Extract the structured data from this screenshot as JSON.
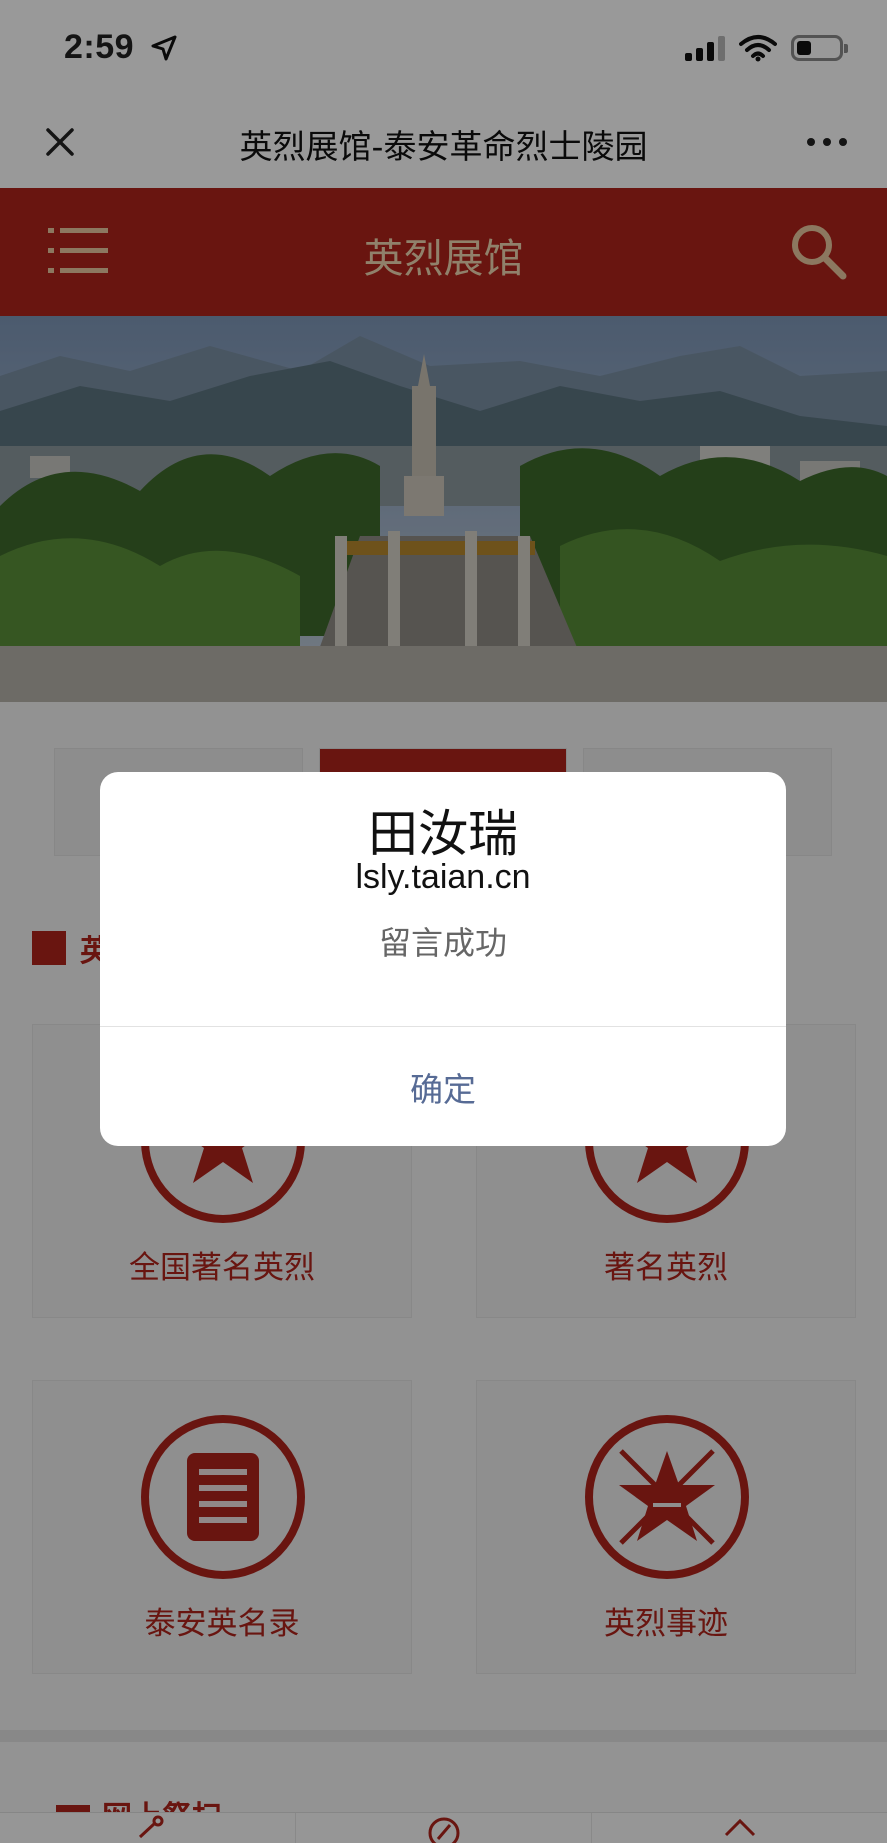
{
  "status_bar": {
    "time": "2:59"
  },
  "wechat_header": {
    "title": "英烈展馆-泰安革命烈士陵园"
  },
  "site_header": {
    "title": "英烈展馆"
  },
  "section": {
    "title": "英"
  },
  "cards": [
    {
      "label": "全国著名英烈",
      "icon": "star-badge-icon"
    },
    {
      "label": "著名英烈",
      "icon": "star-badge-icon"
    },
    {
      "label": "泰安英名录",
      "icon": "document-badge-icon"
    },
    {
      "label": "英烈事迹",
      "icon": "star-rays-badge-icon"
    }
  ],
  "bottom_section": {
    "title": "网上祭扫"
  },
  "dialog": {
    "name": "田汝瑞",
    "domain": "lsly.taian.cn",
    "message": "留言成功",
    "confirm_label": "确定"
  },
  "colors": {
    "brand_red": "#b0231b",
    "header_text": "#f1d7b3",
    "dialog_button": "#576b95"
  }
}
